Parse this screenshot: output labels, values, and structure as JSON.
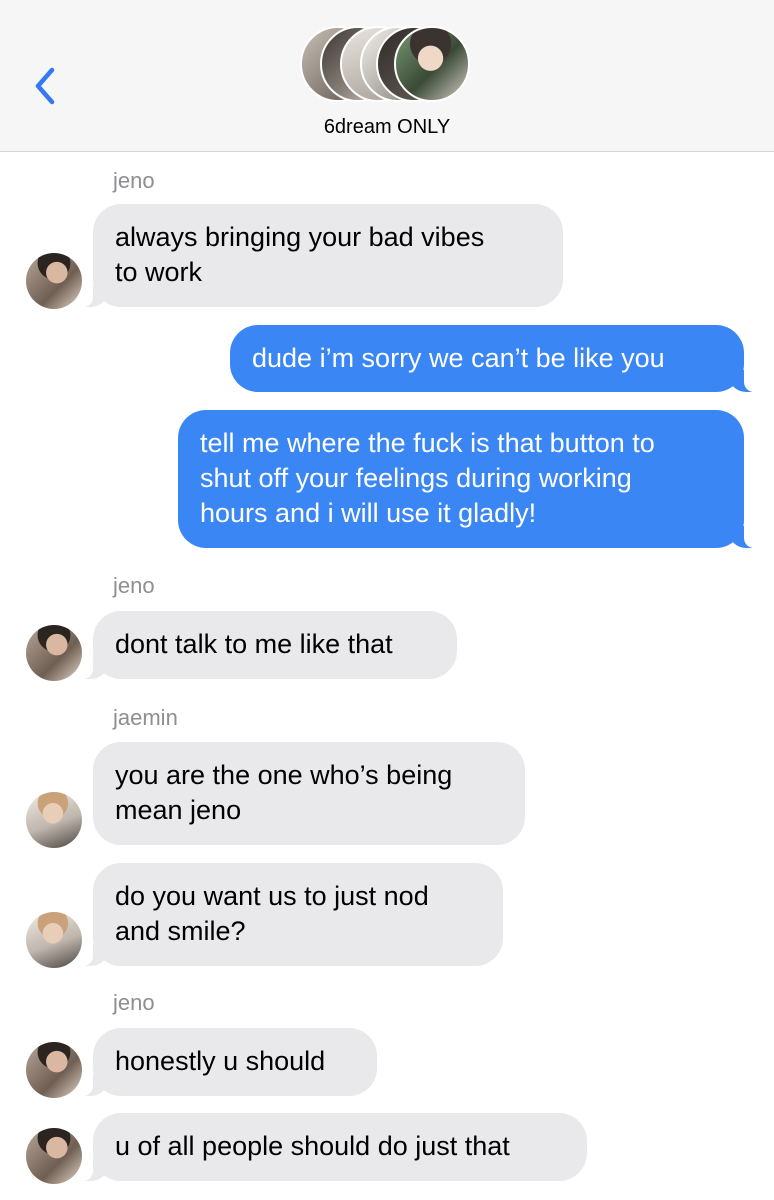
{
  "header": {
    "group_name": "6dream ONLY",
    "back_icon": "chevron-left-icon",
    "accent": "#3478f6"
  },
  "colors": {
    "incoming_bubble": "#e9e9eb",
    "outgoing_bubble": "#3a86f5",
    "sender_label": "#8e8e93"
  },
  "conversation": [
    {
      "type": "sender",
      "name": "jeno"
    },
    {
      "type": "in",
      "sender": "jeno",
      "lines": [
        "always bringing your bad vibes",
        "to work"
      ]
    },
    {
      "type": "out",
      "lines": [
        "dude i’m sorry we can’t be like you"
      ]
    },
    {
      "type": "out",
      "lines": [
        "tell me where the fuck is that button to",
        "shut off your feelings during working",
        "hours and i will use it gladly!"
      ]
    },
    {
      "type": "sender",
      "name": "jeno"
    },
    {
      "type": "in",
      "sender": "jeno",
      "lines": [
        "dont talk to me like that"
      ]
    },
    {
      "type": "sender",
      "name": "jaemin"
    },
    {
      "type": "in",
      "sender": "jaemin",
      "lines": [
        "you are the one who’s being",
        "mean jeno"
      ]
    },
    {
      "type": "in",
      "sender": "jaemin",
      "lines": [
        "do you want us to just nod",
        "and smile?"
      ]
    },
    {
      "type": "sender",
      "name": "jeno"
    },
    {
      "type": "in",
      "sender": "jeno",
      "lines": [
        "honestly u should"
      ]
    },
    {
      "type": "in",
      "sender": "jeno",
      "lines": [
        "u of all people should do just that"
      ]
    }
  ]
}
